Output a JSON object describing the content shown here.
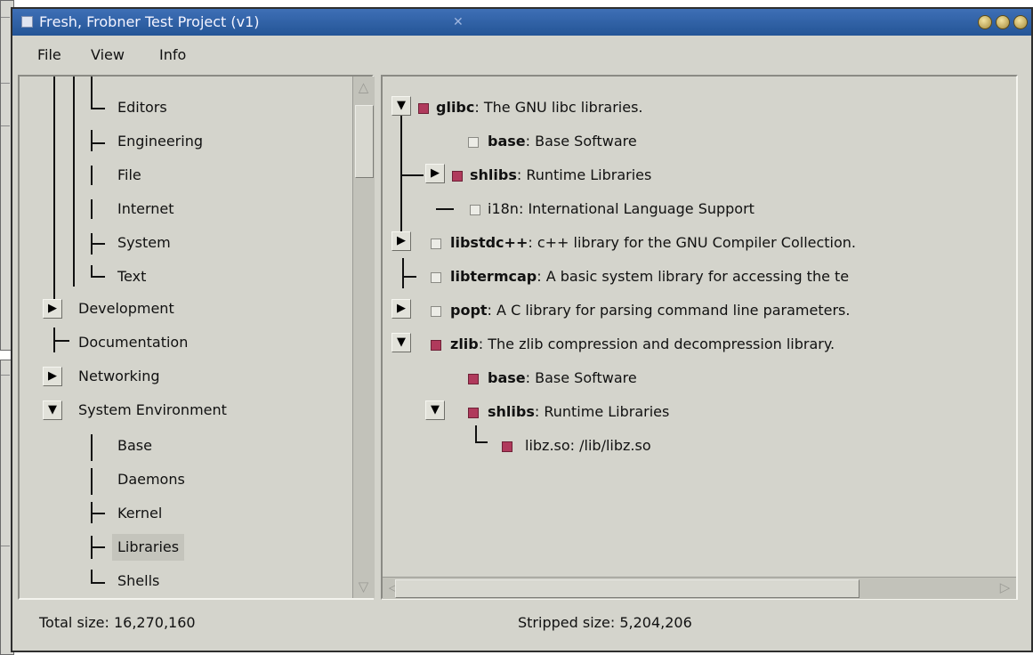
{
  "window": {
    "title": "Frеsh, Frobner Test Project (v1)",
    "pin_glyph": "✕",
    "accent": "#245596"
  },
  "menu": {
    "file": "File",
    "view": "View",
    "info": "Info"
  },
  "left_tree": {
    "items": [
      {
        "label": "Editors"
      },
      {
        "label": "Engineering"
      },
      {
        "label": "File"
      },
      {
        "label": "Internet"
      },
      {
        "label": "System"
      },
      {
        "label": "Text"
      },
      {
        "label": "Development"
      },
      {
        "label": "Documentation"
      },
      {
        "label": "Networking"
      },
      {
        "label": "System Environment"
      },
      {
        "label": "Base"
      },
      {
        "label": "Daemons"
      },
      {
        "label": "Kernel"
      },
      {
        "label": "Libraries"
      },
      {
        "label": "Shells"
      }
    ]
  },
  "packages": {
    "rows": [
      {
        "name": "glibc",
        "desc": "The GNU libc libraries."
      },
      {
        "name": "base",
        "desc": "Base Software"
      },
      {
        "name": "shlibs",
        "desc": "Runtime Libraries"
      },
      {
        "name": "i18n",
        "desc": "International Language Support"
      },
      {
        "name": "libstdc++",
        "desc": "c++ library for the GNU Compiler Collection."
      },
      {
        "name": "libtermcap",
        "desc": "A basic system library for accessing the te"
      },
      {
        "name": "popt",
        "desc": "A C library for parsing command line parameters."
      },
      {
        "name": "zlib",
        "desc": "The zlib compression and decompression library."
      },
      {
        "name": "base",
        "desc": "Base Software"
      },
      {
        "name": "shlibs",
        "desc": "Runtime Libraries"
      },
      {
        "name": "libz.so",
        "desc": "/lib/libz.so"
      }
    ],
    "check_color": "#b03a5c"
  },
  "status": {
    "total": "Total size: 16,270,160",
    "stripped": "Stripped size: 5,204,206"
  }
}
